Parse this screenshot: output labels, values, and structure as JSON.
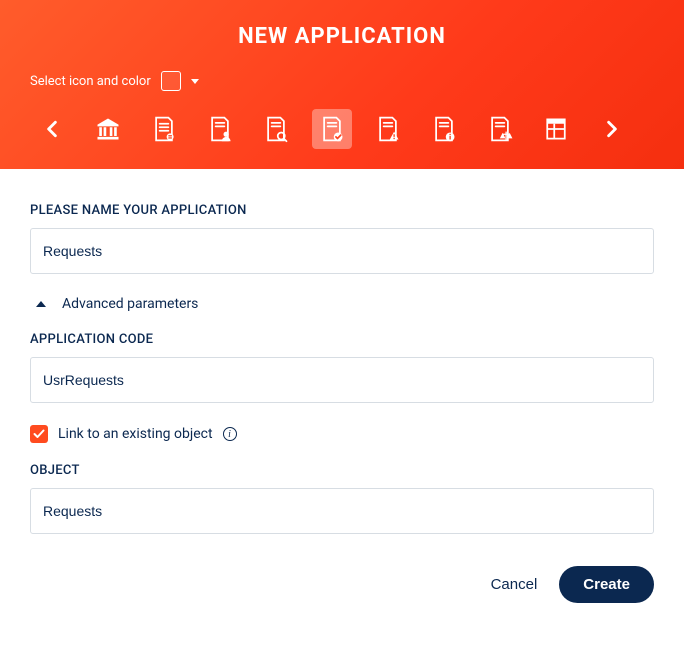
{
  "header": {
    "title": "NEW APPLICATION",
    "select_icon_label": "Select icon and color"
  },
  "form": {
    "name_label": "PLEASE NAME YOUR APPLICATION",
    "name_value": "Requests",
    "advanced_label": "Advanced parameters",
    "code_label": "APPLICATION CODE",
    "code_value": "UsrRequests",
    "link_checkbox_label": "Link to an existing object",
    "link_checkbox_checked": true,
    "object_label": "OBJECT",
    "object_value": "Requests"
  },
  "footer": {
    "cancel_label": "Cancel",
    "create_label": "Create"
  },
  "icons": [
    "bank-icon",
    "doc-lines-icon",
    "doc-person-icon",
    "doc-search-icon",
    "doc-check-icon",
    "doc-warning-icon",
    "doc-info-icon",
    "doc-balance-icon",
    "doc-table-icon"
  ],
  "selected_icon_index": 4,
  "colors": {
    "brand": "#ff4b1f",
    "dark": "#0b2850"
  }
}
